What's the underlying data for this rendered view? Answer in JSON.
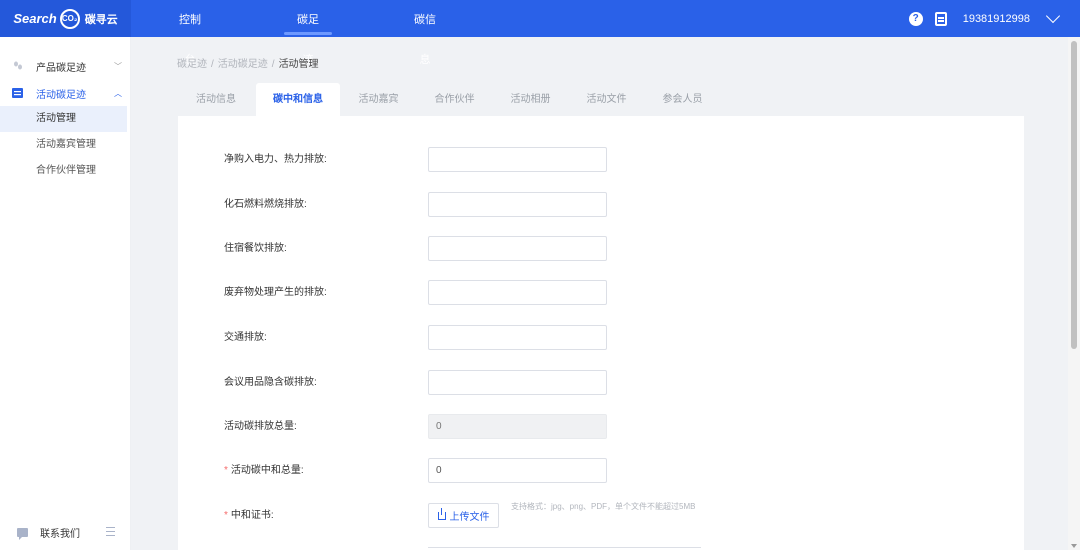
{
  "header": {
    "logo_text": "Search",
    "logo_badge": "CO₂",
    "logo_cn": "碳寻云",
    "nav": [
      "控制台",
      "碳足迹",
      "碳信息"
    ],
    "active_nav": "碳足迹",
    "user_phone": "19381912998"
  },
  "sidebar": {
    "groups": [
      {
        "label": "产品碳足迹",
        "expanded": false
      },
      {
        "label": "活动碳足迹",
        "expanded": true
      }
    ],
    "items": [
      {
        "label": "活动管理",
        "active": true
      },
      {
        "label": "活动嘉宾管理",
        "active": false
      },
      {
        "label": "合作伙伴管理",
        "active": false
      }
    ],
    "contact_label": "联系我们"
  },
  "breadcrumb": [
    "碳足迹",
    "活动碳足迹",
    "活动管理"
  ],
  "tabs": [
    "活动信息",
    "碳中和信息",
    "活动嘉宾",
    "合作伙伴",
    "活动相册",
    "活动文件",
    "参会人员"
  ],
  "active_tab": "碳中和信息",
  "form": {
    "fields": [
      {
        "label": "净购入电力、热力排放:",
        "value": "",
        "required": false,
        "disabled": false
      },
      {
        "label": "化石燃料燃烧排放:",
        "value": "",
        "required": false,
        "disabled": false
      },
      {
        "label": "住宿餐饮排放:",
        "value": "",
        "required": false,
        "disabled": false
      },
      {
        "label": "废弃物处理产生的排放:",
        "value": "",
        "required": false,
        "disabled": false
      },
      {
        "label": "交通排放:",
        "value": "",
        "required": false,
        "disabled": false
      },
      {
        "label": "会议用品隐含碳排放:",
        "value": "",
        "required": false,
        "disabled": false
      },
      {
        "label": "活动碳排放总量:",
        "value": "0",
        "required": false,
        "disabled": true
      },
      {
        "label": "活动碳中和总量:",
        "value": "0",
        "required": true,
        "disabled": false
      }
    ],
    "certificate": {
      "label": "中和证书:",
      "required": true,
      "button_label": "上传文件",
      "hint": "支持格式：jpg、png、PDF，单个文件不能超过5MB"
    }
  },
  "colors": {
    "primary": "#2a61e8",
    "required": "#f56c6c"
  }
}
